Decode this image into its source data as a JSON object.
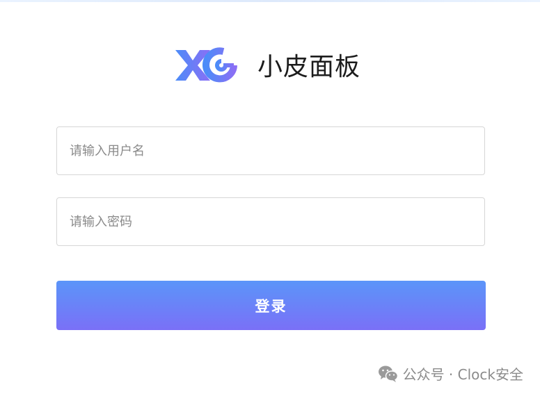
{
  "brand": {
    "logo_icon": "xg-logo-icon",
    "title": "小皮面板"
  },
  "form": {
    "username_placeholder": "请输入用户名",
    "password_placeholder": "请输入密码",
    "login_label": "登录"
  },
  "watermark": {
    "icon": "wechat-icon",
    "text": "公众号 · Clock安全"
  },
  "colors": {
    "logo_gradient_start": "#4c8cf8",
    "logo_gradient_end": "#8a6ff5",
    "button_gradient_start": "#5b95f9",
    "button_gradient_end": "#7a70f7"
  }
}
